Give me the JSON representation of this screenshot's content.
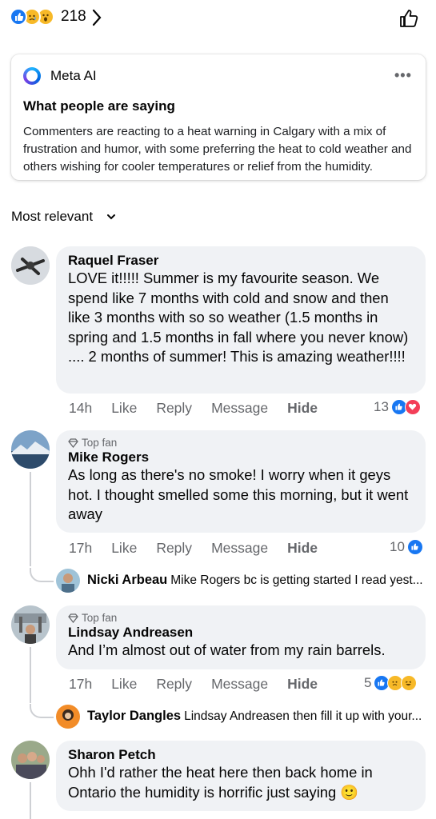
{
  "reactions_bar": {
    "count": "218",
    "icons": [
      "like-icon",
      "sad-icon",
      "wow-icon"
    ]
  },
  "meta_ai": {
    "name": "Meta AI",
    "more": "•••",
    "title": "What people are saying",
    "summary": "Commenters are reacting to a heat warning in Calgary with a mix of frustration and humor, with some preferring the heat to cold weather and others wishing for cooler temperatures or relief from the humidity."
  },
  "sort_label": "Most relevant",
  "action_labels": {
    "like": "Like",
    "reply": "Reply",
    "message": "Message",
    "hide": "Hide"
  },
  "top_fan_label": "Top fan",
  "comments": [
    {
      "name": "Raquel Fraser",
      "text": "LOVE it!!!!! Summer is my favourite season. We spend like 7 months with cold and snow and then like 3 months with so so weather  (1.5 months in spring and 1.5 months in fall where you never know) .... 2 months of summer! This is amazing weather!!!!",
      "time": "14h",
      "reaction_count": "13"
    },
    {
      "name": "Mike Rogers",
      "text": "As long as there's no smoke! I worry when it geys hot. I thought smelled some this morning, but it went away",
      "time": "17h",
      "reaction_count": "10",
      "reply": {
        "name": "Nicki Arbeau",
        "text": "Mike Rogers bc is getting started I read yest..."
      }
    },
    {
      "name": "Lindsay Andreasen",
      "text": "And I’m almost out of water from my rain barrels.",
      "time": "17h",
      "reaction_count": "5",
      "reply": {
        "name": "Taylor Dangles",
        "text": "Lindsay Andreasen then fill it up with your..."
      }
    },
    {
      "name": "Sharon Petch",
      "text": "Ohh I'd rather the heat here then back home in Ontario the humidity is horrific just saying 🙂"
    }
  ],
  "colors": {
    "accent": "#1877f2",
    "love": "#f33e58",
    "emoji": "#f7b928",
    "bubble": "#f0f2f5",
    "muted": "#65676b"
  }
}
